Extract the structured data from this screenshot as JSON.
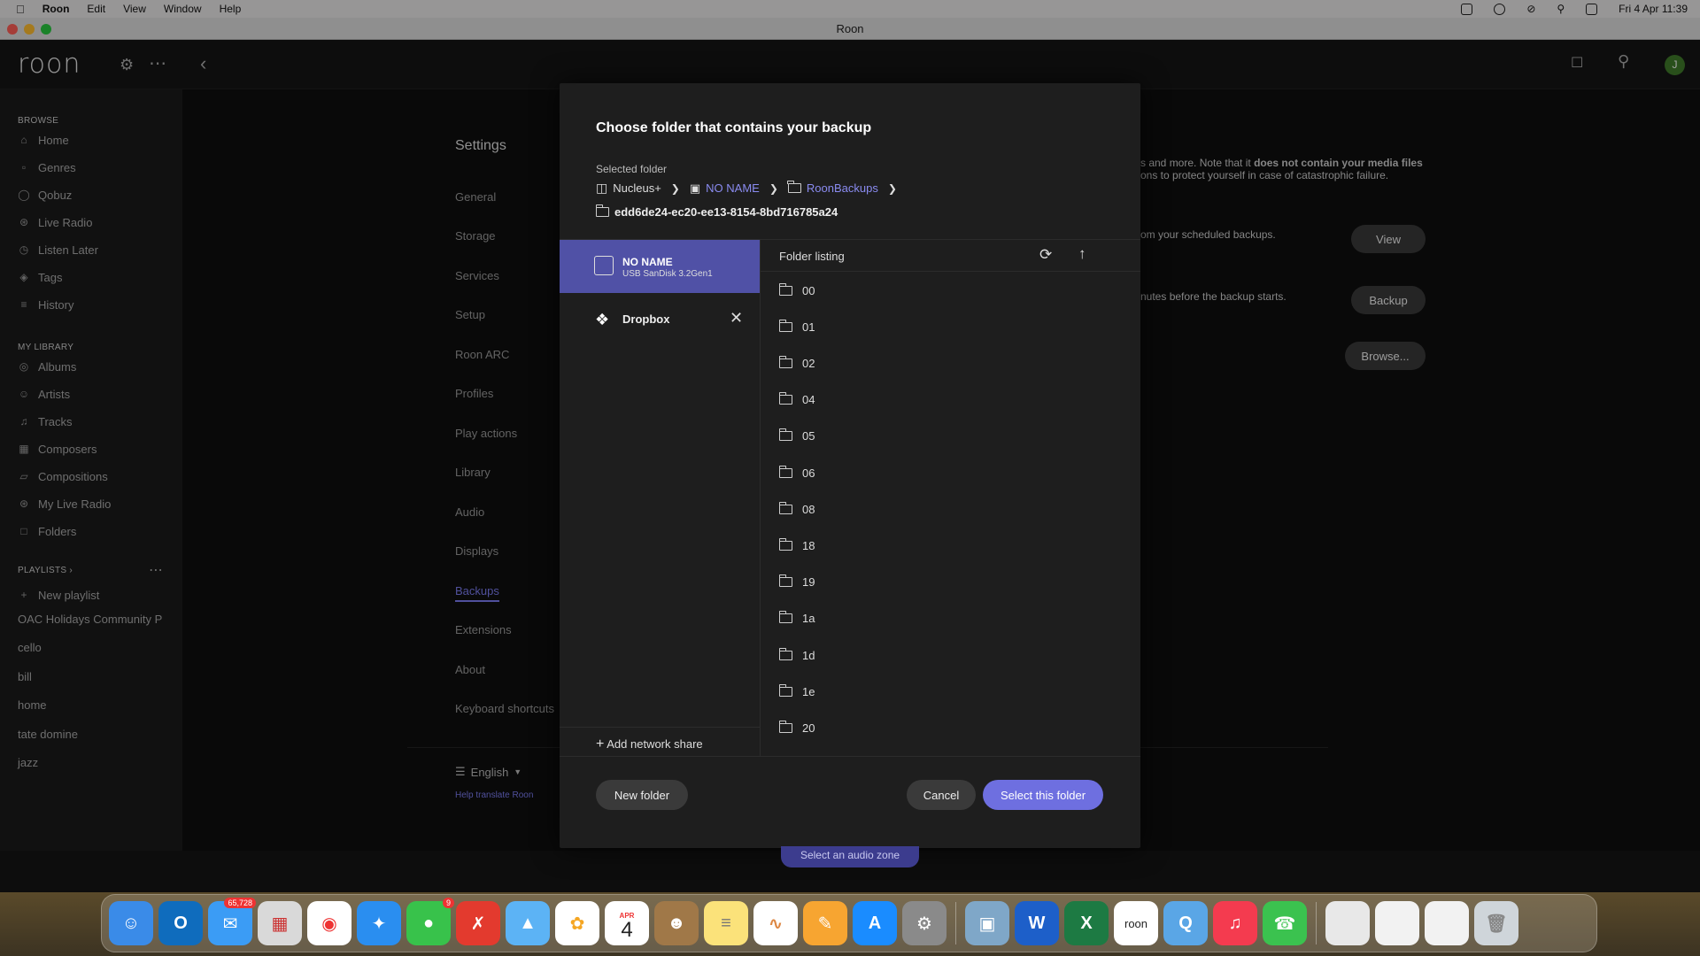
{
  "menubar": {
    "app_name": "Roon",
    "items": [
      "Edit",
      "View",
      "Window",
      "Help"
    ],
    "datetime": "Fri 4 Apr  11:39"
  },
  "window": {
    "title": "Roon"
  },
  "topbar": {
    "logo": "roon",
    "avatar_letter": "J"
  },
  "sidebar": {
    "browse_heading": "BROWSE",
    "browse": [
      {
        "label": "Home",
        "icon": "home-icon"
      },
      {
        "label": "Genres",
        "icon": "genres-icon"
      },
      {
        "label": "Qobuz",
        "icon": "qobuz-icon"
      },
      {
        "label": "Live Radio",
        "icon": "radio-icon"
      },
      {
        "label": "Listen Later",
        "icon": "listen-later-icon"
      },
      {
        "label": "Tags",
        "icon": "tag-icon"
      },
      {
        "label": "History",
        "icon": "history-icon"
      }
    ],
    "library_heading": "MY LIBRARY",
    "library": [
      {
        "label": "Albums",
        "icon": "album-icon"
      },
      {
        "label": "Artists",
        "icon": "artist-icon"
      },
      {
        "label": "Tracks",
        "icon": "note-icon"
      },
      {
        "label": "Composers",
        "icon": "composer-icon"
      },
      {
        "label": "Compositions",
        "icon": "composition-icon"
      },
      {
        "label": "My Live Radio",
        "icon": "radio-icon"
      },
      {
        "label": "Folders",
        "icon": "folder-icon"
      }
    ],
    "playlists_heading": "PLAYLISTS",
    "new_playlist": "New playlist",
    "playlists": [
      "OAC Holidays Community P",
      "cello",
      "bill",
      "home",
      "tate domine",
      "jazz"
    ]
  },
  "settings": {
    "title": "Settings",
    "nav": [
      "General",
      "Storage",
      "Services",
      "Setup",
      "Roon ARC",
      "Profiles",
      "Play actions",
      "Library",
      "Audio",
      "Displays",
      "Backups",
      "Extensions",
      "About",
      "Keyboard shortcuts"
    ],
    "active": "Backups",
    "language": "English",
    "help_translate": "Help translate Roon",
    "bg_text_1a": "s and more. Note that it ",
    "bg_text_1b": "does not contain your media files",
    "bg_text_2": "ons to protect yourself in case of catastrophic failure.",
    "bg_text_3": "om your scheduled backups.",
    "bg_text_4": "nutes before the backup starts.",
    "btn_view": "View",
    "btn_backup": "Backup",
    "btn_browse": "Browse..."
  },
  "modal": {
    "title": "Choose folder that contains your backup",
    "selected_label": "Selected folder",
    "crumbs": [
      "Nucleus+",
      "NO NAME",
      "RoonBackups"
    ],
    "selected_path": "edd6de24-ec20-ee13-8154-8bd716785a24",
    "sources": [
      {
        "name": "NO NAME",
        "sub": "USB SanDisk 3.2Gen1"
      },
      {
        "name": "Dropbox",
        "sub": ""
      }
    ],
    "add_share": "Add network share",
    "listing_title": "Folder listing",
    "folders": [
      "00",
      "01",
      "02",
      "04",
      "05",
      "06",
      "08",
      "18",
      "19",
      "1a",
      "1d",
      "1e",
      "20"
    ],
    "new_folder": "New folder",
    "cancel": "Cancel",
    "select": "Select this folder"
  },
  "zone": {
    "label": "Select an audio zone"
  },
  "dock": {
    "mail_badge": "65,728",
    "messages_badge": "9",
    "calendar_month": "APR",
    "calendar_day": "4"
  }
}
